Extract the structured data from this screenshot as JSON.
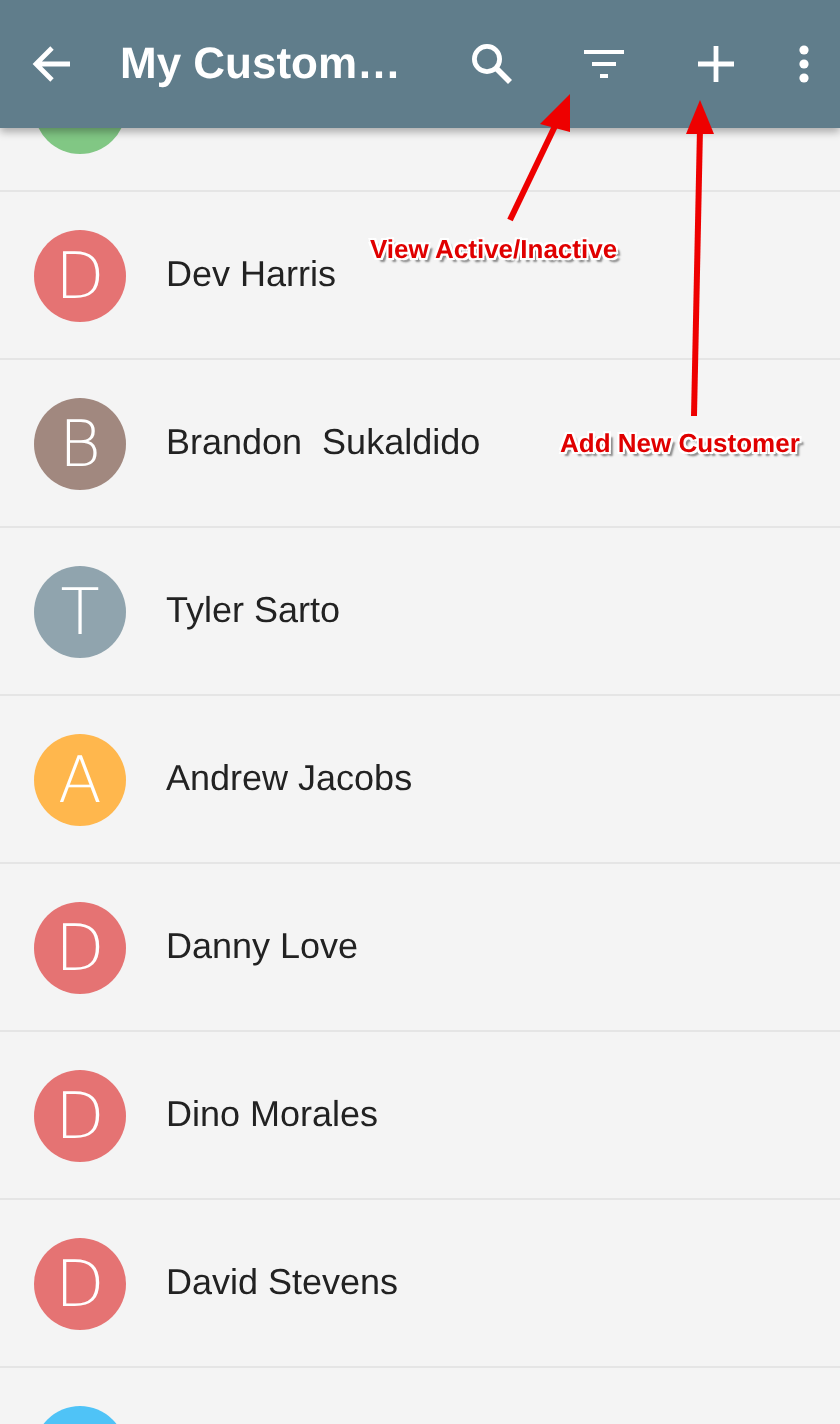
{
  "app_bar": {
    "title": "My Custom…"
  },
  "customers": [
    {
      "color": "#81c784"
    },
    {
      "letter": "D",
      "name": "Dev Harris",
      "color": "#e57373"
    },
    {
      "letter": "B",
      "name": "Brandon  Sukaldido",
      "color": "#a1887f"
    },
    {
      "letter": "T",
      "name": "Tyler Sarto",
      "color": "#90a4ae"
    },
    {
      "letter": "A",
      "name": "Andrew Jacobs",
      "color": "#ffb74d"
    },
    {
      "letter": "D",
      "name": "Danny Love",
      "color": "#e57373"
    },
    {
      "letter": "D",
      "name": "Dino Morales",
      "color": "#e57373"
    },
    {
      "letter": "D",
      "name": "David Stevens",
      "color": "#e57373"
    },
    {
      "color": "#4fc3f7"
    }
  ],
  "annotations": [
    {
      "label": "View Active/Inactive"
    },
    {
      "label": "Add New Customer"
    }
  ]
}
